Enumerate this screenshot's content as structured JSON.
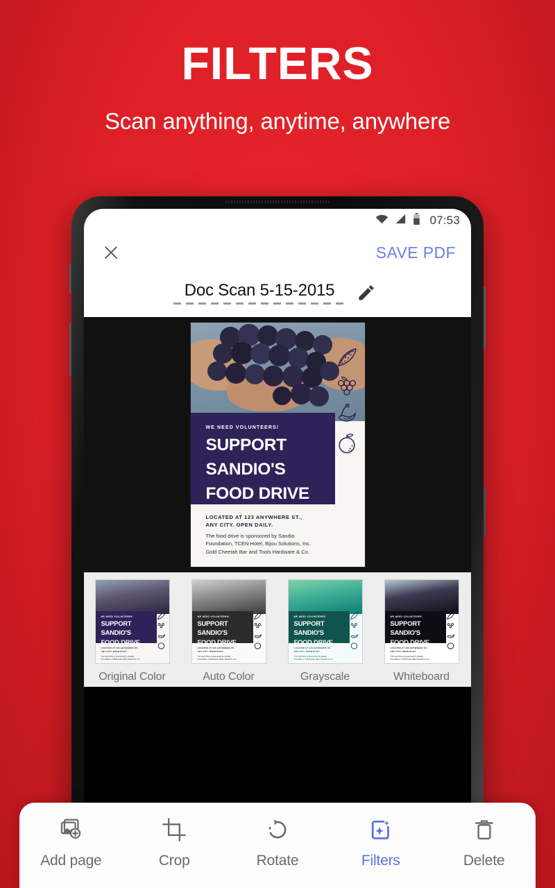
{
  "promo": {
    "headline": "FILTERS",
    "subheadline": "Scan anything, anytime, anywhere",
    "background_color": "#E01F26"
  },
  "phone": {
    "statusbar": {
      "time": "07:53",
      "icons": [
        "wifi-icon",
        "cellular-signal-icon",
        "battery-icon"
      ]
    },
    "appbar": {
      "close_label": "close-icon",
      "save_label": "SAVE PDF",
      "accent_color": "#6B7FE3"
    },
    "document": {
      "title": "Doc Scan 5-15-2015",
      "edit_icon": "pencil-icon"
    }
  },
  "poster": {
    "eyebrow": "WE NEED VOLUNTEERS!",
    "headline_line1": "SUPPORT",
    "headline_line2": "SANDIO'S",
    "headline_line3": "FOOD DRIVE",
    "address_line1": "LOCATED AT 123 ANYWHERE ST.,",
    "address_line2": "ANY CITY. OPEN DAILY.",
    "sponsor_line1": "The food drive is sponsored by Sandio",
    "sponsor_line2": "Foundation, TCEN Hotel, Bijou Solutions, Inc.",
    "sponsor_line3": "Gold Cheetah Bar and Tools Hardware & Co.",
    "band_color": "#2E2259",
    "paper_color": "#F7F6F2",
    "fruit_icons": [
      "watermelon-icon",
      "grapes-icon",
      "bananas-icon",
      "orange-icon"
    ]
  },
  "filters": {
    "selected": "Original Color",
    "items": [
      {
        "label": "Original Color",
        "band": "#2E2259",
        "paper": "#F8F7F3",
        "ink": "#1F1B3A",
        "photo_mode": "color"
      },
      {
        "label": "Auto Color",
        "band": "#2B2B2B",
        "paper": "#FAFAFA",
        "ink": "#222222",
        "photo_mode": "gray"
      },
      {
        "label": "Grayscale",
        "band": "#11544F",
        "paper": "#F4FBFA",
        "ink": "#11544F",
        "photo_mode": "teal"
      },
      {
        "label": "Whiteboard",
        "band": "#0D0D14",
        "paper": "#FFFFFF",
        "ink": "#111111",
        "photo_mode": "contrast"
      }
    ]
  },
  "toolbar": {
    "active": "Filters",
    "active_color": "#5B73DE",
    "items": [
      {
        "label": "Add page",
        "icon": "add-page-icon"
      },
      {
        "label": "Crop",
        "icon": "crop-icon"
      },
      {
        "label": "Rotate",
        "icon": "rotate-icon"
      },
      {
        "label": "Filters",
        "icon": "filters-sparkle-icon"
      },
      {
        "label": "Delete",
        "icon": "trash-icon"
      }
    ]
  }
}
